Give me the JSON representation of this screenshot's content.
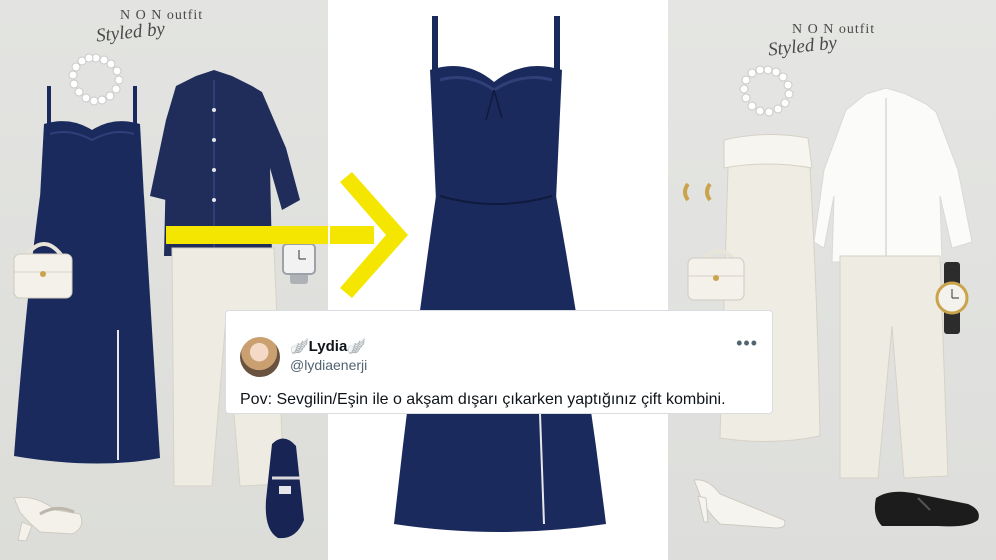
{
  "brand": {
    "name": "N O N outfit",
    "script": "Styled by"
  },
  "tweet": {
    "display_name": "🪽Lydia🪽",
    "handle": "@lydiaenerji",
    "more_icon": "more-options-icon",
    "text": "Pov: Sevgilin/Eşin ile o akşam dışarı çıkarken yaptığınız çift kombini."
  },
  "colors": {
    "navy": "#1b2a5c",
    "cream": "#efece3",
    "arrow_yellow": "#f4e600",
    "panel_gray": "#dfe0dd"
  }
}
